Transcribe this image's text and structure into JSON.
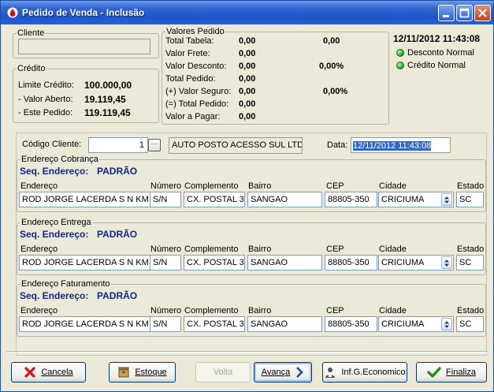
{
  "window": {
    "title": "Pedido de Venda - Inclusão",
    "icon": "app-drop-icon",
    "controls": [
      "minimize-icon",
      "maximize-icon",
      "close-icon"
    ]
  },
  "cliente_group": {
    "legend": "Cliente",
    "value": ""
  },
  "credito_group": {
    "legend": "Crédito",
    "rows": [
      {
        "label": "Limite Crédito:",
        "value": "100.000,00"
      },
      {
        "label": "- Valor Aberto:",
        "value": "19.119,45"
      },
      {
        "label": "- Este Pedido:",
        "value": "119.119,45"
      }
    ]
  },
  "valores_group": {
    "legend": "Valores Pedido",
    "rows": [
      {
        "label": "Total Tabela:",
        "value": "0,00",
        "extra": "0,00"
      },
      {
        "label": "Valor Frete:",
        "value": "0,00",
        "extra": ""
      },
      {
        "label": "Valor Desconto:",
        "value": "0,00",
        "extra": "0,00%"
      },
      {
        "label": "Total Pedido:",
        "value": "0,00",
        "extra": ""
      },
      {
        "label": "(+) Valor Seguro:",
        "value": "0,00",
        "extra": "0,00%"
      },
      {
        "label": "(=) Total Pedido:",
        "value": "0,00",
        "extra": ""
      },
      {
        "label": "Valor a Pagar:",
        "value": "0,00",
        "extra": ""
      }
    ]
  },
  "status": {
    "datetime": "12/11/2012 11:43:08",
    "indicators": [
      {
        "label": "Desconto Normal",
        "color": "#1aa31a"
      },
      {
        "label": "Crédito Normal",
        "color": "#1aa31a"
      }
    ]
  },
  "form": {
    "codigo_label": "Código Cliente:",
    "codigo_value": "1",
    "cliente_nome": "AUTO POSTO ACESSO SUL LTDA",
    "data_label": "Data:",
    "data_value": "12/11/2012 11:43:08"
  },
  "field_labels": {
    "seq": "Seq. Endereço:",
    "endereco": "Endereço",
    "numero": "Número",
    "complemento": "Complemento",
    "bairro": "Bairro",
    "cep": "CEP",
    "cidade": "Cidade",
    "estado": "Estado"
  },
  "addresses": [
    {
      "legend": "Endereço Cobrança",
      "seq": "PADRÃO",
      "endereco": "ROD JORGE LACERDA S N KM",
      "numero": "S/N",
      "complemento": "CX. POSTAL 3",
      "bairro": "SANGAO",
      "cep": "88805-350",
      "cidade": "CRICIUMA",
      "estado": "SC"
    },
    {
      "legend": "Endereço Entrega",
      "seq": "PADRÃO",
      "endereco": "ROD JORGE LACERDA S N KM",
      "numero": "S/N",
      "complemento": "CX. POSTAL 3",
      "bairro": "SANGAO",
      "cep": "88805-350",
      "cidade": "CRICIUMA",
      "estado": "SC"
    },
    {
      "legend": "Endereço Faturamento",
      "seq": "PADRÃO",
      "endereco": "ROD JORGE LACERDA S N KM",
      "numero": "S/N",
      "complemento": "CX. POSTAL 3",
      "bairro": "SANGAO",
      "cep": "88805-350",
      "cidade": "CRICIUMA",
      "estado": "SC"
    }
  ],
  "buttons": {
    "cancelar": {
      "label": "Cancela",
      "icon": "red-x-icon"
    },
    "estoque": {
      "label": "Estoque",
      "icon": "box-icon"
    },
    "volta": {
      "label": "Volta",
      "disabled": true
    },
    "avanca": {
      "label": "Avança",
      "icon": "chevron-right-icon"
    },
    "inf": {
      "label": "Inf.G.Economico",
      "icon": "person-icon"
    },
    "finaliza": {
      "label": "Finaliza",
      "icon": "green-check-icon"
    }
  }
}
